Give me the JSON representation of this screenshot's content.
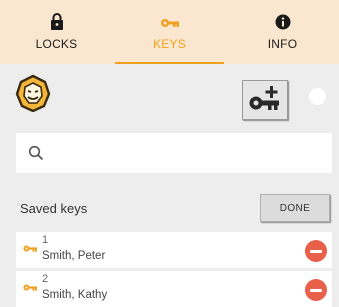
{
  "tabs": [
    {
      "label": "LOCKS",
      "icon": "lock-icon",
      "active": false
    },
    {
      "label": "KEYS",
      "icon": "key-icon",
      "active": true
    },
    {
      "label": "INFO",
      "icon": "info-icon",
      "active": false
    }
  ],
  "toolbar": {
    "logo_icon": "lion-logo-icon",
    "add_key_icon": "add-key-icon"
  },
  "search": {
    "placeholder": "",
    "value": "",
    "icon": "search-icon"
  },
  "saved_keys": {
    "title": "Saved keys",
    "done_label": "DONE",
    "items": [
      {
        "number": "1",
        "name": "Smith, Peter"
      },
      {
        "number": "2",
        "name": "Smith, Kathy"
      }
    ]
  },
  "colors": {
    "accent": "#f0a020",
    "tabbar_bg": "#fbe7cf",
    "delete": "#e8604a",
    "background": "#ededed"
  }
}
